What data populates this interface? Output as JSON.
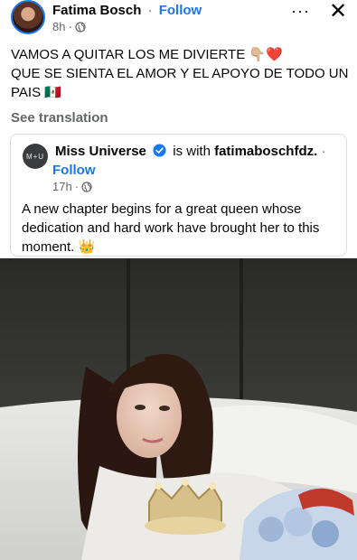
{
  "post": {
    "author": "Fatima Bosch",
    "separator": "·",
    "follow_label": "Follow",
    "time": "8h",
    "time_sep": "·",
    "more_glyph": "···",
    "close_glyph": "✕",
    "text_line1": "VAMOS A QUITAR LOS ME DIVIERTE 👇🏼❤️",
    "text_line2": "QUE SE SIENTA EL AMOR Y EL APOYO DE TODO UN",
    "text_line3": "PAIS 🇲🇽",
    "see_translation": "See translation"
  },
  "shared_post": {
    "logo_text": "M+U",
    "author": "Miss Universe",
    "with_text": "is with",
    "tagged_user": "fatimaboschfdz.",
    "separator": "·",
    "follow_label": "Follow",
    "time": "17h",
    "time_sep": "·",
    "text": "A new chapter begins for a great queen whose dedication and hard work have brought her to this moment. 👑"
  },
  "icons": {
    "globe": "globe-icon",
    "verified": "verified-badge-icon",
    "more": "more-options-icon",
    "close": "close-icon"
  },
  "colors": {
    "accent": "#1877f2",
    "secondary_text": "#65676b",
    "border": "#dadde1"
  }
}
